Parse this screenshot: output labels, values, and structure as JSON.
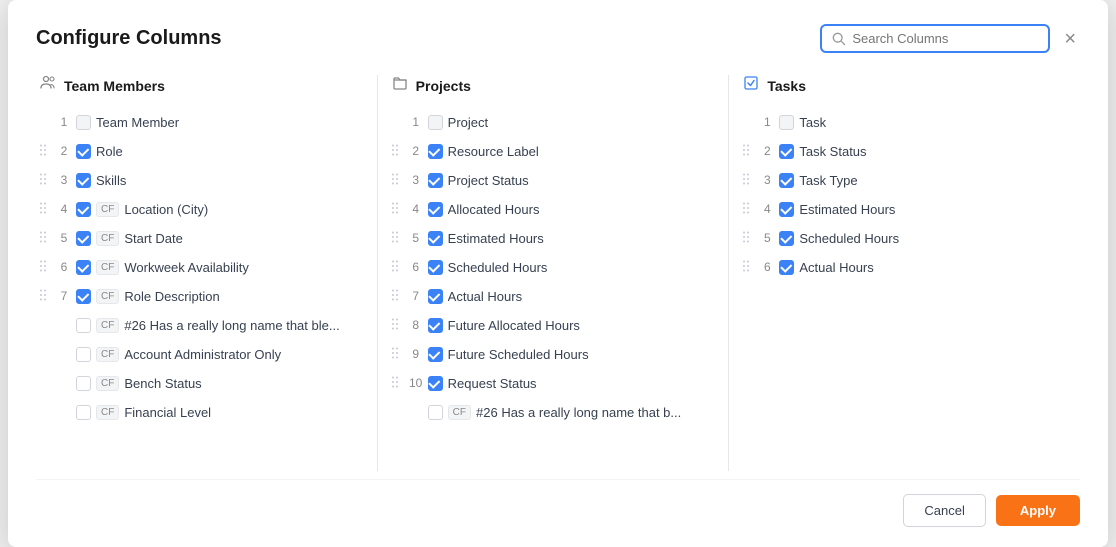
{
  "modal": {
    "title": "Configure Columns",
    "close_label": "×"
  },
  "search": {
    "placeholder": "Search Columns",
    "value": ""
  },
  "footer": {
    "cancel_label": "Cancel",
    "apply_label": "Apply"
  },
  "sections": [
    {
      "id": "team-members",
      "icon": "people-icon",
      "icon_char": "👥",
      "header": "Team Members",
      "items": [
        {
          "num": "1",
          "checked": false,
          "disabled": true,
          "cf": false,
          "label": "Team Member",
          "drag": false
        },
        {
          "num": "2",
          "checked": true,
          "disabled": false,
          "cf": false,
          "label": "Role",
          "drag": true
        },
        {
          "num": "3",
          "checked": true,
          "disabled": false,
          "cf": false,
          "label": "Skills",
          "drag": true
        },
        {
          "num": "4",
          "checked": true,
          "disabled": false,
          "cf": true,
          "label": "Location (City)",
          "drag": true
        },
        {
          "num": "5",
          "checked": true,
          "disabled": false,
          "cf": true,
          "label": "Start Date",
          "drag": true
        },
        {
          "num": "6",
          "checked": true,
          "disabled": false,
          "cf": true,
          "label": "Workweek Availability",
          "drag": true
        },
        {
          "num": "7",
          "checked": true,
          "disabled": false,
          "cf": true,
          "label": "Role Description",
          "drag": true
        },
        {
          "num": "",
          "checked": false,
          "disabled": false,
          "cf": true,
          "label": "#26 Has a really long name that ble...",
          "drag": false
        },
        {
          "num": "",
          "checked": false,
          "disabled": false,
          "cf": true,
          "label": "Account Administrator Only",
          "drag": false
        },
        {
          "num": "",
          "checked": false,
          "disabled": false,
          "cf": true,
          "label": "Bench Status",
          "drag": false
        },
        {
          "num": "",
          "checked": false,
          "disabled": false,
          "cf": true,
          "label": "Financial Level",
          "drag": false
        }
      ]
    },
    {
      "id": "projects",
      "icon": "folder-icon",
      "icon_char": "📁",
      "header": "Projects",
      "items": [
        {
          "num": "1",
          "checked": false,
          "disabled": true,
          "cf": false,
          "label": "Project",
          "drag": false
        },
        {
          "num": "2",
          "checked": true,
          "disabled": false,
          "cf": false,
          "label": "Resource Label",
          "drag": true
        },
        {
          "num": "3",
          "checked": true,
          "disabled": false,
          "cf": false,
          "label": "Project Status",
          "drag": true
        },
        {
          "num": "4",
          "checked": true,
          "disabled": false,
          "cf": false,
          "label": "Allocated Hours",
          "drag": true
        },
        {
          "num": "5",
          "checked": true,
          "disabled": false,
          "cf": false,
          "label": "Estimated Hours",
          "drag": true
        },
        {
          "num": "6",
          "checked": true,
          "disabled": false,
          "cf": false,
          "label": "Scheduled Hours",
          "drag": true
        },
        {
          "num": "7",
          "checked": true,
          "disabled": false,
          "cf": false,
          "label": "Actual Hours",
          "drag": true
        },
        {
          "num": "8",
          "checked": true,
          "disabled": false,
          "cf": false,
          "label": "Future Allocated Hours",
          "drag": true
        },
        {
          "num": "9",
          "checked": true,
          "disabled": false,
          "cf": false,
          "label": "Future Scheduled Hours",
          "drag": true
        },
        {
          "num": "10",
          "checked": true,
          "disabled": false,
          "cf": false,
          "label": "Request Status",
          "drag": true
        },
        {
          "num": "",
          "checked": false,
          "disabled": false,
          "cf": true,
          "label": "#26 Has a really long name that b...",
          "drag": false
        }
      ]
    },
    {
      "id": "tasks",
      "icon": "tasks-icon",
      "icon_char": "☑",
      "header": "Tasks",
      "items": [
        {
          "num": "1",
          "checked": false,
          "disabled": true,
          "cf": false,
          "label": "Task",
          "drag": false
        },
        {
          "num": "2",
          "checked": true,
          "disabled": false,
          "cf": false,
          "label": "Task Status",
          "drag": true
        },
        {
          "num": "3",
          "checked": true,
          "disabled": false,
          "cf": false,
          "label": "Task Type",
          "drag": true
        },
        {
          "num": "4",
          "checked": true,
          "disabled": false,
          "cf": false,
          "label": "Estimated Hours",
          "drag": true
        },
        {
          "num": "5",
          "checked": true,
          "disabled": false,
          "cf": false,
          "label": "Scheduled Hours",
          "drag": true
        },
        {
          "num": "6",
          "checked": true,
          "disabled": false,
          "cf": false,
          "label": "Actual Hours",
          "drag": true
        }
      ]
    }
  ]
}
